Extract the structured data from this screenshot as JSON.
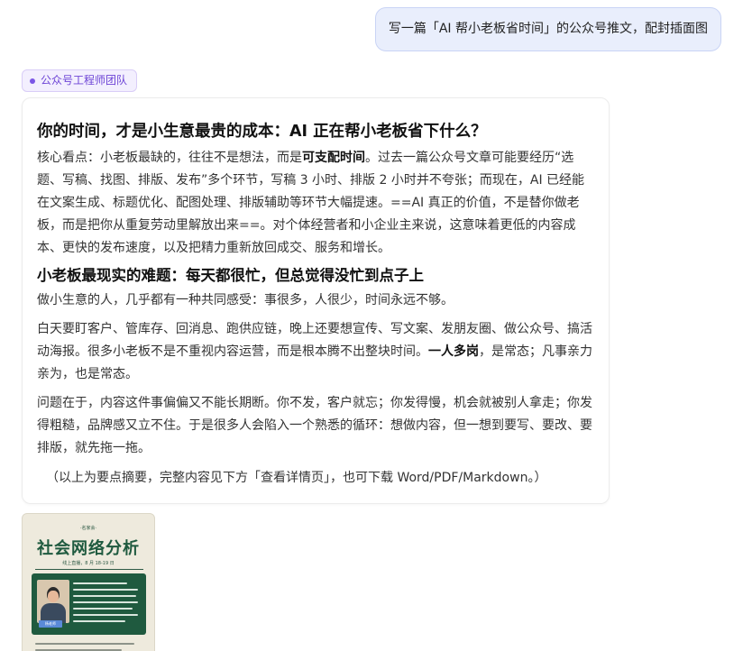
{
  "user_message": "写一篇「AI 帮小老板省时间」的公众号推文，配封插面图",
  "agent_tag": "公众号工程师团队",
  "article": {
    "title": "你的时间，才是小生意最贵的成本：AI 正在帮小老板省下什么？",
    "core_label": "核心看点：",
    "core_text_1": "小老板最缺的，往往不是想法，而是",
    "core_bold": "可支配时间",
    "core_text_2": "。过去一篇公众号文章可能要经历“选题、写稿、找图、排版、发布”多个环节，写稿 3 小时、排版 2 小时并不夸张；而现在，AI 已经能在文案生成、标题优化、配图处理、排版辅助等环节大幅提速。==AI 真正的价值，不是替你做老板，而是把你从重复劳动里解放出来==。对个体经营者和小企业主来说，这意味着更低的内容成本、更快的发布速度，以及把精力重新放回成交、服务和增长。",
    "section_title": "小老板最现实的难题：每天都很忙，但总觉得没忙到点子上",
    "para_1": "做小生意的人，几乎都有一种共同感受：事很多，人很少，时间永远不够。",
    "para_2_a": "白天要盯客户、管库存、回消息、跑供应链，晚上还要想宣传、写文案、发朋友圈、做公众号、搞活动海报。很多小老板不是不重视内容运营，而是根本腾不出整块时间。",
    "para_2_bold": "一人多岗",
    "para_2_b": "，是常态；凡事亲力亲为，也是常态。",
    "para_3": "问题在于，内容这件事偏偏又不能长期断。你不发，客户就忘；你发得慢，机会就被别人拿走；你发得粗糙，品牌感又立不住。于是很多人会陷入一个熟悉的循环：想做内容，但一想到要写、要改、要排版，就先拖一拖。",
    "note": "（以上为要点摘要，完整内容见下方「查看详情页」，也可下载 Word/PDF/Markdown。）"
  },
  "poster": {
    "top_small": "·名家会·",
    "title": "社会网络分析",
    "subtitle": "线上直播，8 月 18-19 日",
    "name_badge": "杨老师"
  },
  "colors": {
    "user_bubble_bg": "#e9eefc",
    "tag_accent": "#6d44d6",
    "poster_green": "#1f5a3f"
  }
}
